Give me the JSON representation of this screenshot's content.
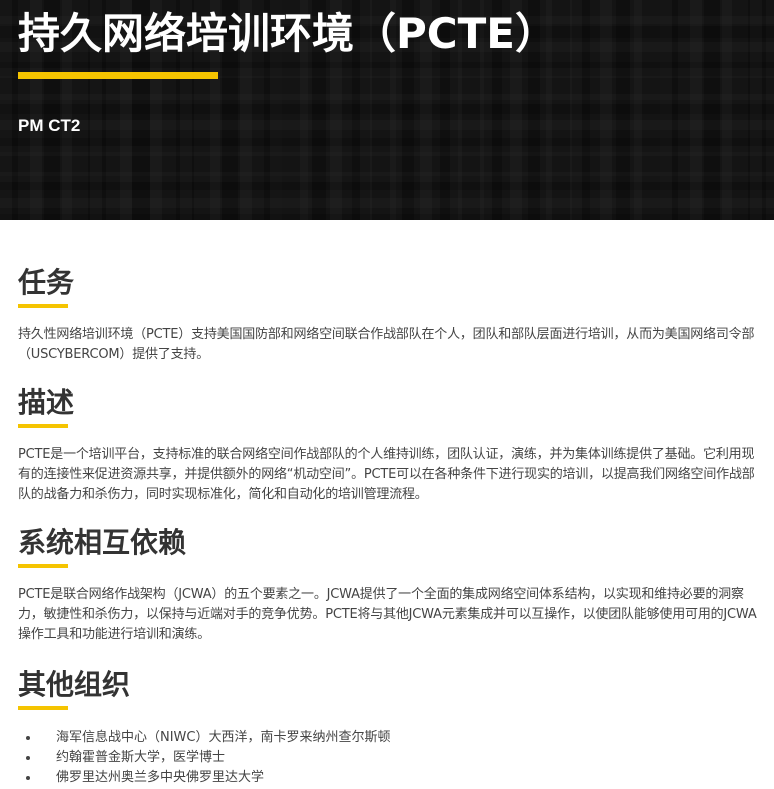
{
  "header": {
    "title": "持久网络培训环境（PCTE）",
    "subtitle": "PM CT2"
  },
  "sections": {
    "mission": {
      "heading": "任务",
      "text": "持久性网络培训环境（PCTE）支持美国国防部和网络空间联合作战部队在个人，团队和部队层面进行培训，从而为美国网络司令部（USCYBERCOM）提供了支持。"
    },
    "description": {
      "heading": "描述",
      "text": "PCTE是一个培训平台，支持标准的联合网络空间作战部队的个人维持训练，团队认证，演练，并为集体训练提供了基础。它利用现有的连接性来促进资源共享，并提供额外的网络“机动空间”。PCTE可以在各种条件下进行现实的培训，以提高我们网络空间作战部队的战备力和杀伤力，同时实现标准化，简化和自动化的培训管理流程。"
    },
    "interdependency": {
      "heading": "系统相互依赖",
      "text": "PCTE是联合网络作战架构（JCWA）的五个要素之一。JCWA提供了一个全面的集成网络空间体系结构，以实现和维持必要的洞察力，敏捷性和杀伤力，以保持与近端对手的竞争优势。PCTE将与其他JCWA元素集成并可以互操作，以使团队能够使用可用的JCWA操作工具和功能进行培训和演练。"
    },
    "orgs": {
      "heading": "其他组织",
      "items": [
        "海军信息战中心（NIWC）大西洋，南卡罗来纳州查尔斯顿",
        "约翰霍普金斯大学，医学博士",
        "佛罗里达州奥兰多中央佛罗里达大学"
      ]
    }
  },
  "colors": {
    "accent": "#f5c400",
    "hero_background": "#141414",
    "text": "#444444"
  }
}
